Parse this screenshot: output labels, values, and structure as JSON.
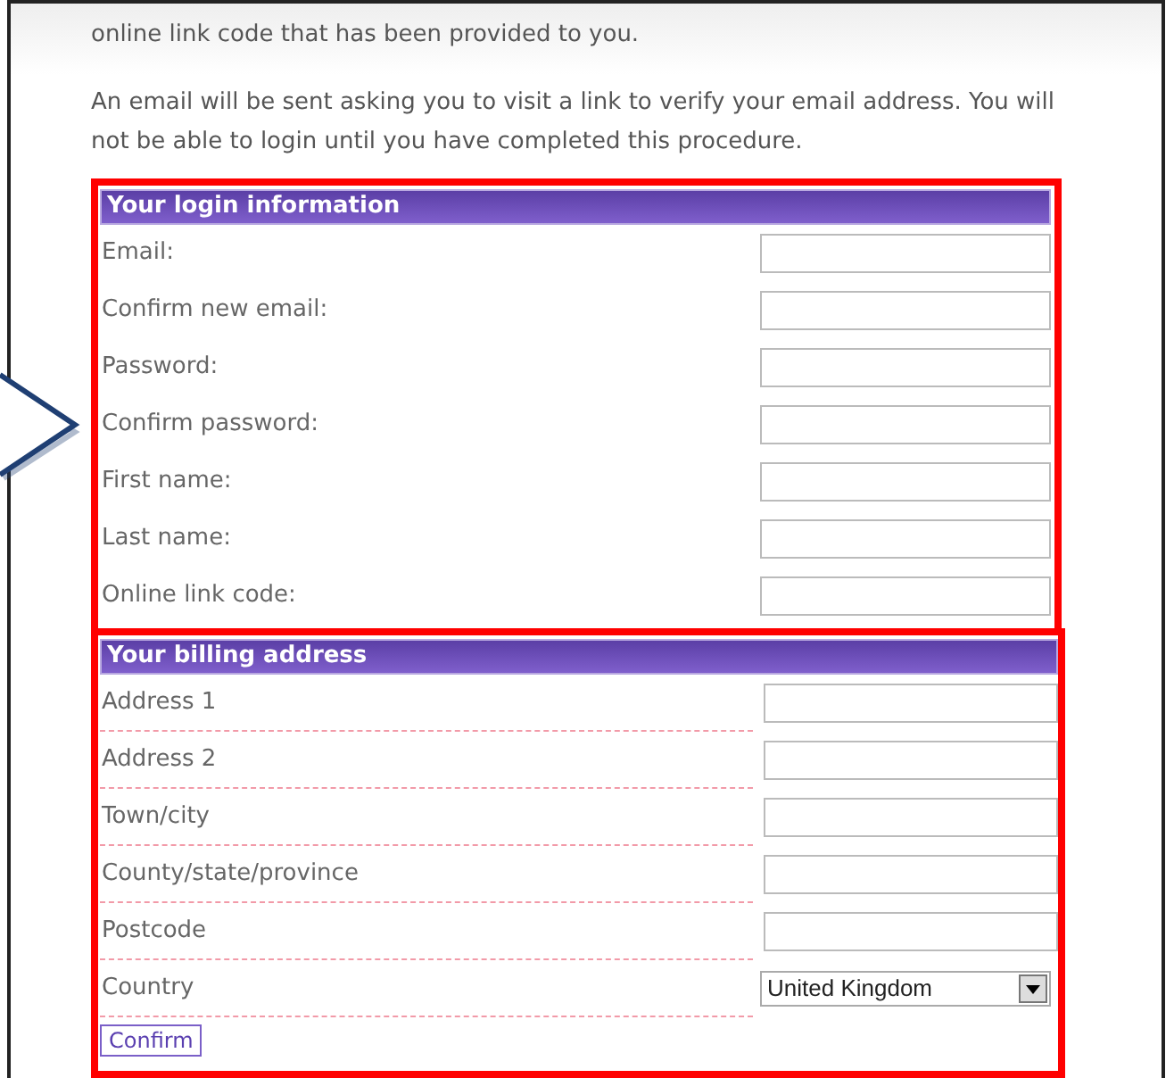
{
  "intro": [
    "online link code that has been provided to you.",
    "An email will be sent asking you to visit a link to verify your email address. You will not be able to login until you have completed this procedure."
  ],
  "login": {
    "title": "Your login information",
    "fields": [
      {
        "label": "Email:"
      },
      {
        "label": "Confirm new email:"
      },
      {
        "label": "Password:"
      },
      {
        "label": "Confirm password:"
      },
      {
        "label": "First name:"
      },
      {
        "label": "Last name:"
      },
      {
        "label": "Online link code:"
      }
    ]
  },
  "billing": {
    "title": "Your billing address",
    "fields": [
      {
        "label": "Address 1",
        "kind": "text"
      },
      {
        "label": "Address 2",
        "kind": "text"
      },
      {
        "label": "Town/city",
        "kind": "text"
      },
      {
        "label": "County/state/province",
        "kind": "text"
      },
      {
        "label": "Postcode",
        "kind": "text"
      },
      {
        "label": "Country",
        "kind": "select",
        "value": "United Kingdom"
      }
    ]
  },
  "confirm_button": "Confirm"
}
